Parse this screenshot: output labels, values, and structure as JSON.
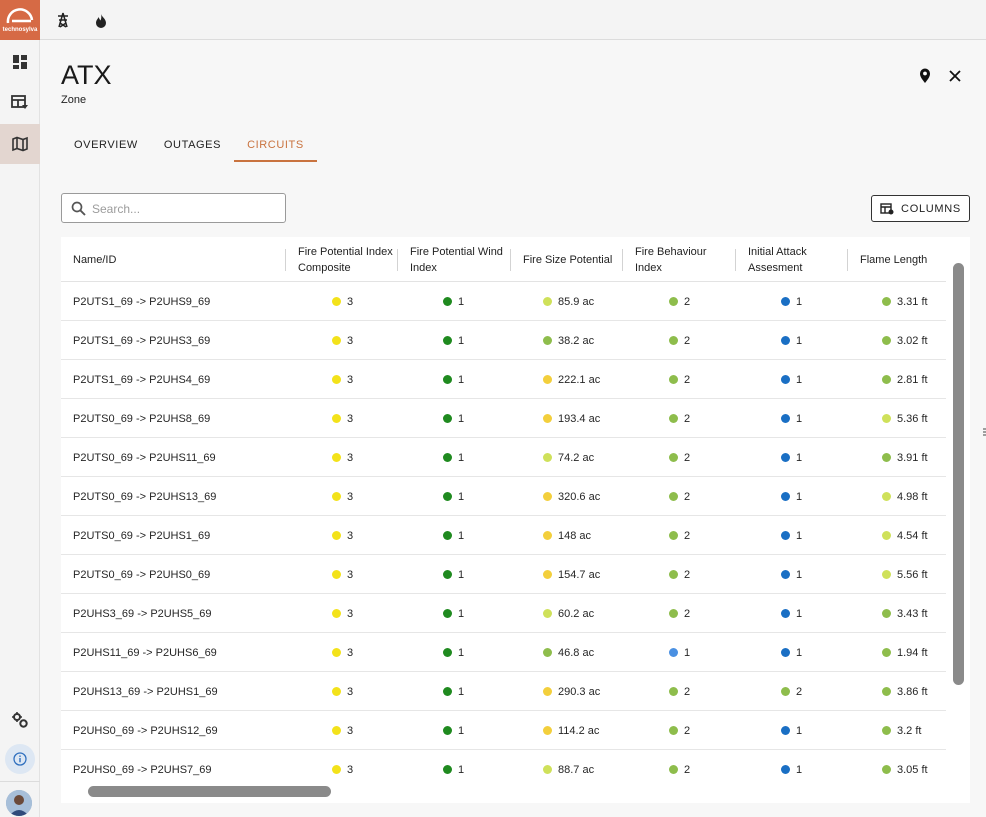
{
  "app": {
    "logo_text": "technosylva"
  },
  "header": {
    "title": "ATX",
    "subtitle": "Zone"
  },
  "tabs": [
    {
      "label": "OVERVIEW",
      "active": false
    },
    {
      "label": "OUTAGES",
      "active": false
    },
    {
      "label": "CIRCUITS",
      "active": true
    }
  ],
  "search": {
    "placeholder": "Search...",
    "value": ""
  },
  "toolbar": {
    "columns_label": "COLUMNS"
  },
  "colors": {
    "yellow": "#f3e21a",
    "green": "#1f8a1f",
    "light_green": "#cfe15a",
    "olive": "#8ebd4c",
    "gold": "#f3cf3c",
    "blue": "#1a6fc4",
    "light_blue": "#4a90e2",
    "accent": "#c9733f"
  },
  "table": {
    "columns": [
      "Name/ID",
      "Fire Potential Index Composite",
      "Fire Potential Wind Index",
      "Fire Size Potential",
      "Fire Behaviour Index",
      "Initial Attack Assesment",
      "Flame Length"
    ],
    "rows": [
      {
        "name": "P2UTS1_69 -> P2UHS9_69",
        "fpi": {
          "v": "3",
          "c": "yellow"
        },
        "wind": {
          "v": "1",
          "c": "green"
        },
        "size": {
          "v": "85.9 ac",
          "c": "light_green"
        },
        "fbi": {
          "v": "2",
          "c": "olive"
        },
        "ia": {
          "v": "1",
          "c": "blue"
        },
        "flame": {
          "v": "3.31 ft",
          "c": "olive"
        }
      },
      {
        "name": "P2UTS1_69 -> P2UHS3_69",
        "fpi": {
          "v": "3",
          "c": "yellow"
        },
        "wind": {
          "v": "1",
          "c": "green"
        },
        "size": {
          "v": "38.2 ac",
          "c": "olive"
        },
        "fbi": {
          "v": "2",
          "c": "olive"
        },
        "ia": {
          "v": "1",
          "c": "blue"
        },
        "flame": {
          "v": "3.02 ft",
          "c": "olive"
        }
      },
      {
        "name": "P2UTS1_69 -> P2UHS4_69",
        "fpi": {
          "v": "3",
          "c": "yellow"
        },
        "wind": {
          "v": "1",
          "c": "green"
        },
        "size": {
          "v": "222.1 ac",
          "c": "gold"
        },
        "fbi": {
          "v": "2",
          "c": "olive"
        },
        "ia": {
          "v": "1",
          "c": "blue"
        },
        "flame": {
          "v": "2.81 ft",
          "c": "olive"
        }
      },
      {
        "name": "P2UTS0_69 -> P2UHS8_69",
        "fpi": {
          "v": "3",
          "c": "yellow"
        },
        "wind": {
          "v": "1",
          "c": "green"
        },
        "size": {
          "v": "193.4 ac",
          "c": "gold"
        },
        "fbi": {
          "v": "2",
          "c": "olive"
        },
        "ia": {
          "v": "1",
          "c": "blue"
        },
        "flame": {
          "v": "5.36 ft",
          "c": "light_green"
        }
      },
      {
        "name": "P2UTS0_69 -> P2UHS11_69",
        "fpi": {
          "v": "3",
          "c": "yellow"
        },
        "wind": {
          "v": "1",
          "c": "green"
        },
        "size": {
          "v": "74.2 ac",
          "c": "light_green"
        },
        "fbi": {
          "v": "2",
          "c": "olive"
        },
        "ia": {
          "v": "1",
          "c": "blue"
        },
        "flame": {
          "v": "3.91 ft",
          "c": "olive"
        }
      },
      {
        "name": "P2UTS0_69 -> P2UHS13_69",
        "fpi": {
          "v": "3",
          "c": "yellow"
        },
        "wind": {
          "v": "1",
          "c": "green"
        },
        "size": {
          "v": "320.6 ac",
          "c": "gold"
        },
        "fbi": {
          "v": "2",
          "c": "olive"
        },
        "ia": {
          "v": "1",
          "c": "blue"
        },
        "flame": {
          "v": "4.98 ft",
          "c": "light_green"
        }
      },
      {
        "name": "P2UTS0_69 -> P2UHS1_69",
        "fpi": {
          "v": "3",
          "c": "yellow"
        },
        "wind": {
          "v": "1",
          "c": "green"
        },
        "size": {
          "v": "148 ac",
          "c": "gold"
        },
        "fbi": {
          "v": "2",
          "c": "olive"
        },
        "ia": {
          "v": "1",
          "c": "blue"
        },
        "flame": {
          "v": "4.54 ft",
          "c": "light_green"
        }
      },
      {
        "name": "P2UTS0_69 -> P2UHS0_69",
        "fpi": {
          "v": "3",
          "c": "yellow"
        },
        "wind": {
          "v": "1",
          "c": "green"
        },
        "size": {
          "v": "154.7 ac",
          "c": "gold"
        },
        "fbi": {
          "v": "2",
          "c": "olive"
        },
        "ia": {
          "v": "1",
          "c": "blue"
        },
        "flame": {
          "v": "5.56 ft",
          "c": "light_green"
        }
      },
      {
        "name": "P2UHS3_69 -> P2UHS5_69",
        "fpi": {
          "v": "3",
          "c": "yellow"
        },
        "wind": {
          "v": "1",
          "c": "green"
        },
        "size": {
          "v": "60.2 ac",
          "c": "light_green"
        },
        "fbi": {
          "v": "2",
          "c": "olive"
        },
        "ia": {
          "v": "1",
          "c": "blue"
        },
        "flame": {
          "v": "3.43 ft",
          "c": "olive"
        }
      },
      {
        "name": "P2UHS11_69 -> P2UHS6_69",
        "fpi": {
          "v": "3",
          "c": "yellow"
        },
        "wind": {
          "v": "1",
          "c": "green"
        },
        "size": {
          "v": "46.8 ac",
          "c": "olive"
        },
        "fbi": {
          "v": "1",
          "c": "light_blue"
        },
        "ia": {
          "v": "1",
          "c": "blue"
        },
        "flame": {
          "v": "1.94 ft",
          "c": "olive"
        }
      },
      {
        "name": "P2UHS13_69 -> P2UHS1_69",
        "fpi": {
          "v": "3",
          "c": "yellow"
        },
        "wind": {
          "v": "1",
          "c": "green"
        },
        "size": {
          "v": "290.3 ac",
          "c": "gold"
        },
        "fbi": {
          "v": "2",
          "c": "olive"
        },
        "ia": {
          "v": "2",
          "c": "olive"
        },
        "flame": {
          "v": "3.86 ft",
          "c": "olive"
        }
      },
      {
        "name": "P2UHS0_69 -> P2UHS12_69",
        "fpi": {
          "v": "3",
          "c": "yellow"
        },
        "wind": {
          "v": "1",
          "c": "green"
        },
        "size": {
          "v": "114.2 ac",
          "c": "gold"
        },
        "fbi": {
          "v": "2",
          "c": "olive"
        },
        "ia": {
          "v": "1",
          "c": "blue"
        },
        "flame": {
          "v": "3.2 ft",
          "c": "olive"
        }
      },
      {
        "name": "P2UHS0_69 -> P2UHS7_69",
        "fpi": {
          "v": "3",
          "c": "yellow"
        },
        "wind": {
          "v": "1",
          "c": "green"
        },
        "size": {
          "v": "88.7 ac",
          "c": "light_green"
        },
        "fbi": {
          "v": "2",
          "c": "olive"
        },
        "ia": {
          "v": "1",
          "c": "blue"
        },
        "flame": {
          "v": "3.05 ft",
          "c": "olive"
        }
      }
    ]
  }
}
